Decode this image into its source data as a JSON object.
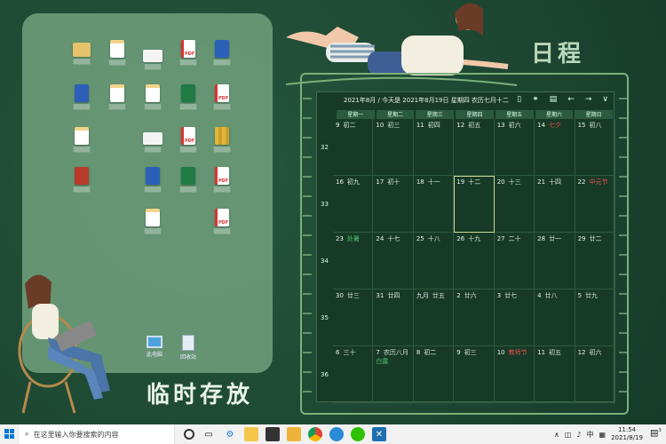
{
  "panel": {
    "title": "临时存放",
    "icons": [
      {
        "type": "folder",
        "label": "▒▒▒▒"
      },
      {
        "type": "doc",
        "label": "▒▒▒▒"
      },
      {
        "type": "img",
        "label": "▒▒▒▒"
      },
      {
        "type": "pdf",
        "label": "▒▒▒▒"
      },
      {
        "type": "word",
        "label": "▒▒▒▒"
      },
      {
        "type": "word",
        "label": "▒▒▒▒"
      },
      {
        "type": "doc",
        "label": "▒▒▒▒"
      },
      {
        "type": "doc",
        "label": "▒▒▒▒"
      },
      {
        "type": "excel",
        "label": "▒▒▒▒"
      },
      {
        "type": "pdf",
        "label": "▒▒▒▒"
      },
      {
        "type": "doc",
        "label": "▒▒▒▒"
      },
      {
        "type": "img",
        "label": "▒▒▒▒"
      },
      {
        "type": "pdf",
        "label": "▒▒▒▒"
      },
      {
        "type": "zip",
        "label": "▒▒▒▒"
      },
      {
        "type": "red",
        "label": "▒▒▒▒"
      },
      {
        "type": "word",
        "label": "▒▒▒▒"
      },
      {
        "type": "excel",
        "label": "▒▒▒▒"
      },
      {
        "type": "pdf",
        "label": "▒▒▒▒"
      },
      {
        "type": "doc",
        "label": "▒▒▒▒"
      },
      {
        "type": "pdf",
        "label": "▒▒▒▒"
      },
      {
        "type": "pc",
        "label": "此电脑"
      },
      {
        "type": "bin",
        "label": "回收站"
      }
    ]
  },
  "schedule": {
    "title": "日程",
    "header": "2021年8月 / 今天是 2021年8月19日 星期四 农历七月十二",
    "tool_icons": [
      "phone-icon",
      "link-icon",
      "calendar-icon",
      "arrow-left-icon",
      "arrow-right-icon",
      "chevron-down-icon"
    ],
    "weekdays": [
      "星期一",
      "星期二",
      "星期三",
      "星期四",
      "星期五",
      "星期六",
      "星期日"
    ],
    "weeknums": [
      "32",
      "33",
      "34",
      "35",
      "36"
    ],
    "weeks": [
      [
        {
          "d": "9",
          "l": "初二"
        },
        {
          "d": "10",
          "l": "初三"
        },
        {
          "d": "11",
          "l": "初四"
        },
        {
          "d": "12",
          "l": "初五"
        },
        {
          "d": "13",
          "l": "初六"
        },
        {
          "d": "14",
          "l": "七夕",
          "c": "red"
        },
        {
          "d": "15",
          "l": "初八"
        }
      ],
      [
        {
          "d": "16",
          "l": "初九"
        },
        {
          "d": "17",
          "l": "初十"
        },
        {
          "d": "18",
          "l": "十一"
        },
        {
          "d": "19",
          "l": "十二",
          "today": true
        },
        {
          "d": "20",
          "l": "十三"
        },
        {
          "d": "21",
          "l": "十四"
        },
        {
          "d": "22",
          "l": "中元节",
          "c": "red"
        }
      ],
      [
        {
          "d": "23",
          "l": "处暑",
          "c": "green"
        },
        {
          "d": "24",
          "l": "十七"
        },
        {
          "d": "25",
          "l": "十八"
        },
        {
          "d": "26",
          "l": "十九"
        },
        {
          "d": "27",
          "l": "二十"
        },
        {
          "d": "28",
          "l": "廿一"
        },
        {
          "d": "29",
          "l": "廿二"
        }
      ],
      [
        {
          "d": "30",
          "l": "廿三"
        },
        {
          "d": "31",
          "l": "廿四"
        },
        {
          "d": "九月",
          "l": "廿五"
        },
        {
          "d": "2",
          "l": "廿六"
        },
        {
          "d": "3",
          "l": "廿七"
        },
        {
          "d": "4",
          "l": "廿八"
        },
        {
          "d": "5",
          "l": "廿九"
        }
      ],
      [
        {
          "d": "6",
          "l": "三十"
        },
        {
          "d": "7",
          "l": "农历八月",
          "c2": "白露"
        },
        {
          "d": "8",
          "l": "初二"
        },
        {
          "d": "9",
          "l": "初三"
        },
        {
          "d": "10",
          "l": "教师节",
          "c": "red"
        },
        {
          "d": "11",
          "l": "初五"
        },
        {
          "d": "12",
          "l": "初六"
        }
      ]
    ]
  },
  "taskbar": {
    "search_placeholder": "在这里输入你要搜索的内容",
    "time": "11:54",
    "date": "2021/8/19",
    "ime": "中",
    "notification_count": "3"
  }
}
